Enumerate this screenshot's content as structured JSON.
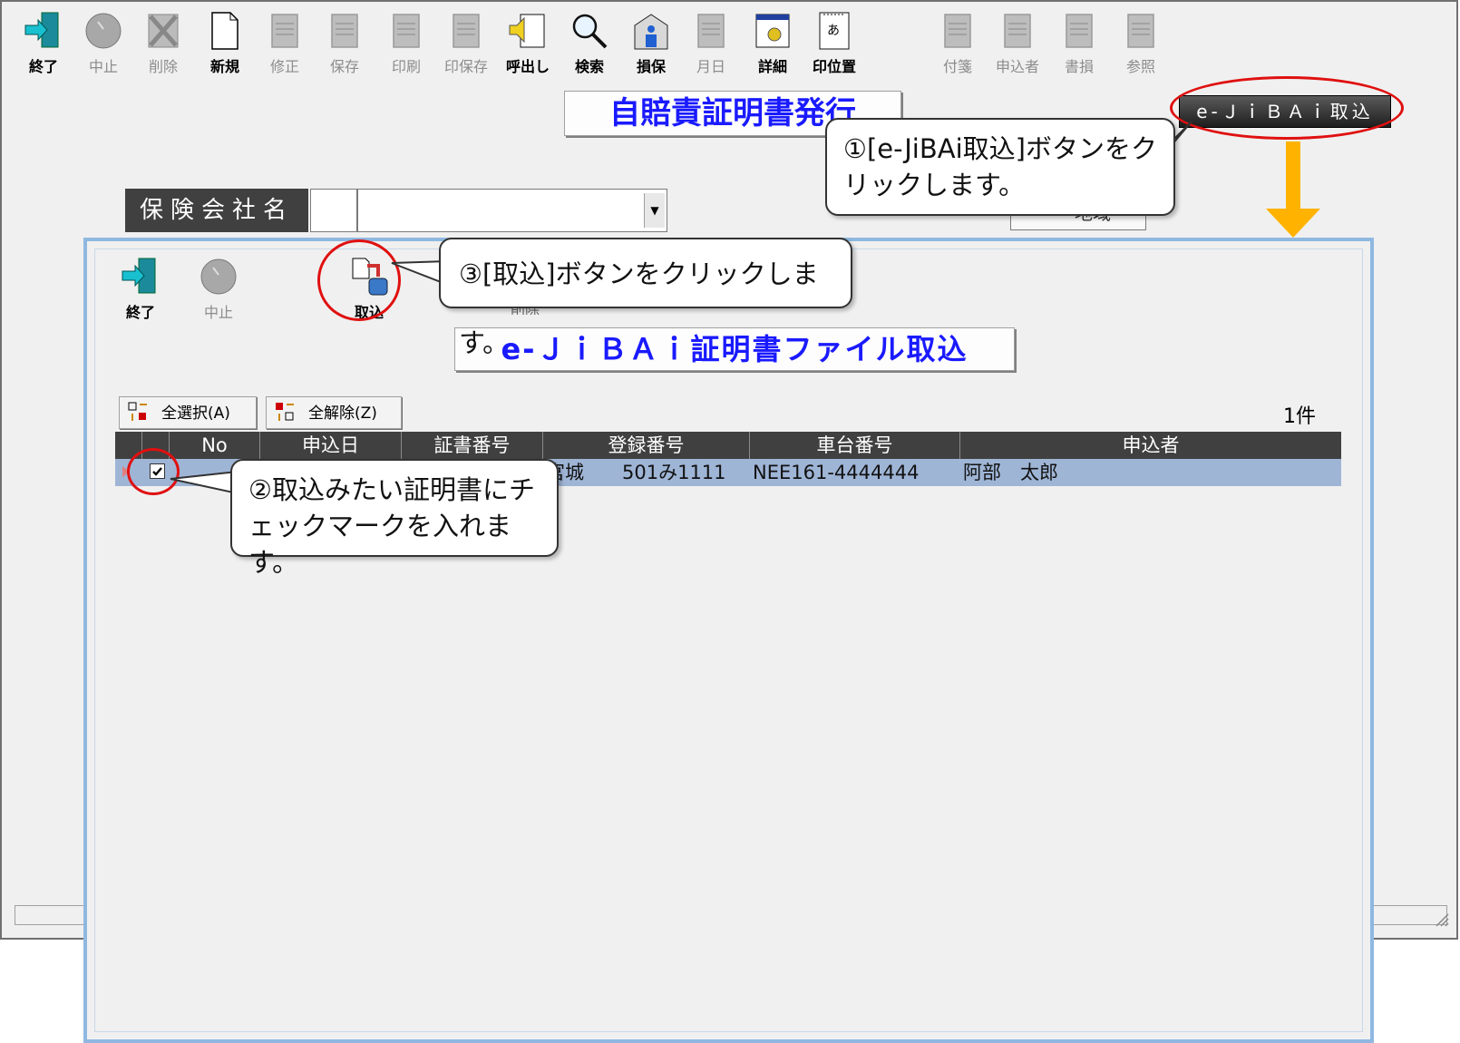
{
  "main_toolbar": [
    {
      "label": "終了",
      "enabled": true,
      "icon": "exit-door-icon"
    },
    {
      "label": "中止",
      "enabled": false,
      "icon": "stop-circle-icon"
    },
    {
      "label": "削除",
      "enabled": false,
      "icon": "delete-x-icon"
    },
    {
      "label": "新規",
      "enabled": true,
      "icon": "new-document-icon"
    },
    {
      "label": "修正",
      "enabled": false,
      "icon": "edit-document-icon"
    },
    {
      "label": "保存",
      "enabled": false,
      "icon": "save-icon"
    },
    {
      "label": "印刷",
      "enabled": false,
      "icon": "printer-icon"
    },
    {
      "label": "印保存",
      "enabled": false,
      "icon": "print-save-icon"
    },
    {
      "label": "呼出し",
      "enabled": true,
      "icon": "recall-speaker-icon"
    },
    {
      "label": "検索",
      "enabled": true,
      "icon": "magnifier-icon"
    },
    {
      "label": "損保",
      "enabled": true,
      "icon": "insurance-building-icon"
    },
    {
      "label": "月日",
      "enabled": false,
      "icon": "calendar-icon"
    },
    {
      "label": "詳細",
      "enabled": true,
      "icon": "detail-window-icon"
    },
    {
      "label": "印位置",
      "enabled": true,
      "icon": "print-position-icon"
    },
    {
      "label": "付箋",
      "enabled": false,
      "icon": "sticky-note-icon"
    },
    {
      "label": "申込者",
      "enabled": false,
      "icon": "applicant-icon"
    },
    {
      "label": "書損",
      "enabled": false,
      "icon": "spoiled-document-icon"
    },
    {
      "label": "参照",
      "enabled": false,
      "icon": "reference-icon"
    }
  ],
  "main_title": "自賠責証明書発行",
  "ejibai_button": "e-ＪｉＢＡｉ取込",
  "insurance_company_label": "保険会社名",
  "behind_text": "地域",
  "dialog": {
    "toolbar": [
      {
        "label": "終了",
        "enabled": true,
        "icon": "exit-door-icon"
      },
      {
        "label": "中止",
        "enabled": false,
        "icon": "stop-circle-icon"
      },
      {
        "label": "取込",
        "enabled": true,
        "icon": "import-icon"
      }
    ],
    "partial_label": "削除",
    "title": "e-ＪｉＢＡｉ証明書ファイル取込",
    "select_all": "全選択(A)",
    "deselect_all": "全解除(Z)",
    "count": "1件",
    "columns": [
      "No",
      "申込日",
      "証書番号",
      "登録番号",
      "車台番号",
      "申込者"
    ],
    "rows": [
      {
        "checked": true,
        "no": "",
        "date": "",
        "cert_no": "",
        "reg_no": "宮城　　501み1111",
        "chassis": "NEE161-4444444",
        "applicant": "阿部　太郎"
      }
    ]
  },
  "callouts": {
    "step1": "①[e-JiBAi取込]ボタンをクリックします。",
    "step2": "②取込みたい証明書にチェックマークを入れます。",
    "step3": "③[取込]ボタンをクリックします。"
  },
  "colors": {
    "accent_arrow": "#ffb300",
    "highlight_ring": "#e01010",
    "row_selected": "#9fb5d6",
    "title_text": "#1a1aff"
  }
}
